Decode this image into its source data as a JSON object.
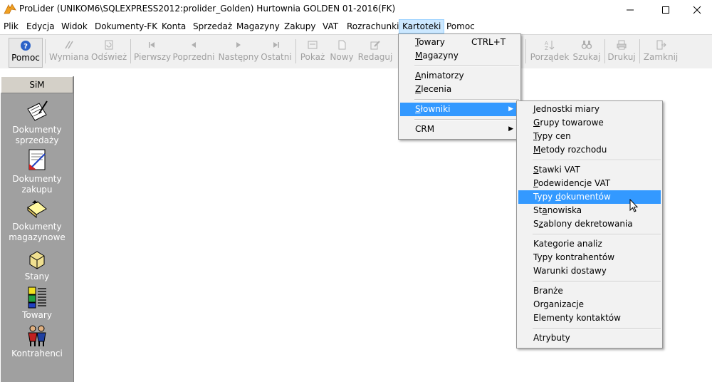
{
  "window": {
    "title": "ProLider  (UNIKOM6\\SQLEXPRESS2012:prolider_Golden) Hurtownia GOLDEN 01-2016(FK)",
    "icon": "prolider-app-icon"
  },
  "menubar": {
    "items": [
      "Plik",
      "Edycja",
      "Widok",
      "Dokumenty-FK",
      "Konta",
      "Sprzedaż",
      "Magazyny",
      "Zakupy",
      "VAT",
      "Rozrachunki",
      "Kartoteki",
      "Pomoc"
    ],
    "active": "Kartoteki"
  },
  "toolbar": {
    "buttons": [
      {
        "label": "Pomoc",
        "icon": "help-icon",
        "enabled": true
      },
      {
        "label": "Wymiana",
        "icon": "exchange-icon",
        "enabled": false
      },
      {
        "label": "Odśwież",
        "icon": "refresh-icon",
        "enabled": false
      },
      {
        "label": "Pierwszy",
        "icon": "first-record-icon",
        "enabled": false
      },
      {
        "label": "Poprzedni",
        "icon": "previous-record-icon",
        "enabled": false
      },
      {
        "label": "Następny",
        "icon": "next-record-icon",
        "enabled": false
      },
      {
        "label": "Ostatni",
        "icon": "last-record-icon",
        "enabled": false
      },
      {
        "label": "Pokaż",
        "icon": "show-icon",
        "enabled": false
      },
      {
        "label": "Nowy",
        "icon": "new-icon",
        "enabled": false
      },
      {
        "label": "Redaguj",
        "icon": "edit-icon",
        "enabled": false
      },
      {
        "label": "Porządek",
        "icon": "sort-icon",
        "enabled": false
      },
      {
        "label": "Szukaj",
        "icon": "binoculars-icon",
        "enabled": false
      },
      {
        "label": "Drukuj",
        "icon": "printer-icon",
        "enabled": false
      },
      {
        "label": "Zamknij",
        "icon": "close-door-icon",
        "enabled": false
      }
    ]
  },
  "sidebar": {
    "header": "SiM",
    "items": [
      {
        "label": "Dokumenty\nsprzedaży",
        "icon": "sales-documents-icon"
      },
      {
        "label": "Dokumenty\nzakupu",
        "icon": "purchase-documents-icon"
      },
      {
        "label": "Dokumenty\nmagazynowe",
        "icon": "warehouse-documents-icon"
      },
      {
        "label": "Stany",
        "icon": "stock-icon"
      },
      {
        "label": "Towary",
        "icon": "goods-icon"
      },
      {
        "label": "Kontrahenci",
        "icon": "contractors-icon"
      }
    ]
  },
  "kartoteki_menu": {
    "items": [
      {
        "label": "Towary",
        "accel": "T",
        "shortcut": "CTRL+T"
      },
      {
        "label": "Magazyny",
        "accel": "M"
      },
      {
        "label": "Animatorzy",
        "accel": "A"
      },
      {
        "label": "Zlecenia",
        "accel": "Z"
      },
      {
        "label": "Słowniki",
        "accel": "S",
        "submenu": true,
        "highlighted": true
      },
      {
        "label": "CRM",
        "submenu": true
      }
    ]
  },
  "slowniki_menu": {
    "items": [
      "Jednostki miary",
      "Grupy towarowe",
      "Typy cen",
      "Metody rozchodu",
      "Stawki VAT",
      "Podewidencje VAT",
      "Typy dokumentów",
      "Stanowiska",
      "Szablony dekretowania",
      "Kategorie analiz",
      "Typy kontrahentów",
      "Warunki dostawy",
      "Branże",
      "Organizacje",
      "Elementy kontaktów",
      "Atrybuty"
    ],
    "highlighted": "Typy dokumentów"
  },
  "colors": {
    "menu_highlight": "#3399ff",
    "active_menu": "#cce8ff",
    "sidebar_bg": "#a0a0a0"
  }
}
